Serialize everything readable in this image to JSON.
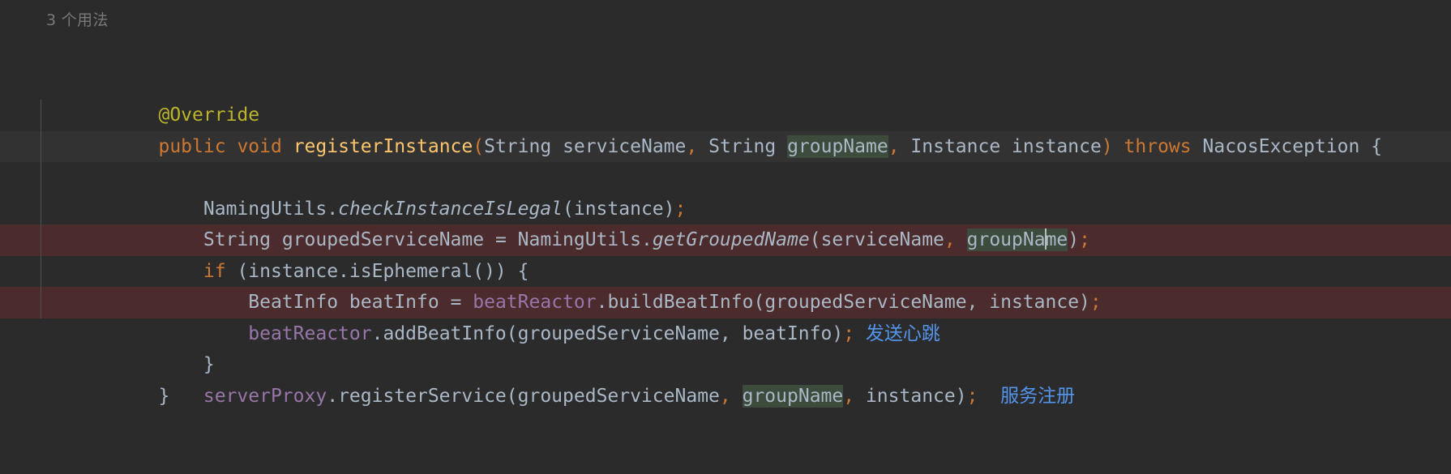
{
  "editor": {
    "theme": "darcula",
    "background": "#2B2B2B",
    "caret_line_background": "#323232",
    "changed_line_background": "#4B2B2B",
    "occurrence_highlight_color": "#3C4B3C",
    "default_text_color": "#A9B7C6"
  },
  "code_vision": {
    "usages_hint": "3 个用法"
  },
  "colors": {
    "keyword": "#CC7832",
    "annotation": "#BBB529",
    "method_name": "#FFC66D",
    "field": "#9876AA",
    "identifier": "#A9B7C6",
    "comment_chinese": "#5394EC",
    "gutter_guide": "#4F5254",
    "hint_gray": "#787878"
  },
  "code": {
    "line_annotation": {
      "annotation": "@Override"
    },
    "signature": {
      "modifier": "public",
      "return_type": "void",
      "method_name": "registerInstance",
      "paren_open": "(",
      "param1_type": "String",
      "param1_name": "serviceName",
      "comma1": ",",
      "param2_type": "String",
      "param2_name": "groupName",
      "comma2": ",",
      "param3_type": "Instance",
      "param3_name": "instance",
      "paren_close": ")",
      "throws_kw": "throws",
      "exception_type": "NacosException",
      "brace_open": "{"
    },
    "line_check": {
      "indent": "    ",
      "class_name": "NamingUtils",
      "dot": ".",
      "method": "checkInstanceIsLegal",
      "args": "(instance)",
      "semicolon": ";"
    },
    "line_grouped": {
      "indent": "    ",
      "type": "String",
      "var": "groupedServiceName",
      "assign": "=",
      "class_name": "NamingUtils",
      "dot": ".",
      "method": "getGroupedName",
      "paren_open": "(",
      "arg1": "serviceName",
      "comma": ",",
      "arg2_a": "groupNa",
      "arg2_b": "me",
      "paren_close": ")",
      "semicolon": ";"
    },
    "line_if": {
      "indent": "    ",
      "kw_if": "if",
      "cond": "(instance.isEphemeral())",
      "brace_open": "{"
    },
    "line_beatinfo": {
      "indent": "        ",
      "type": "BeatInfo",
      "var": "beatInfo",
      "assign": "=",
      "field": "beatReactor",
      "dot": ".",
      "method": "buildBeatInfo",
      "args": "(groupedServiceName, instance)",
      "semicolon": ";"
    },
    "line_addbeat": {
      "indent": "        ",
      "field": "beatReactor",
      "dot": ".",
      "method": "addBeatInfo",
      "args": "(groupedServiceName, beatInfo)",
      "semicolon": ";",
      "comment": "发送心跳"
    },
    "line_close_if": {
      "indent": "    ",
      "brace_close": "}"
    },
    "line_register": {
      "indent": "    ",
      "field": "serverProxy",
      "dot": ".",
      "method": "registerService",
      "paren_open": "(",
      "arg1": "groupedServiceName",
      "comma1": ",",
      "arg2": "groupName",
      "comma2": ",",
      "arg3": "instance",
      "paren_close": ")",
      "semicolon": ";",
      "comment": "服务注册"
    },
    "line_close_method": {
      "brace_close": "}"
    }
  }
}
